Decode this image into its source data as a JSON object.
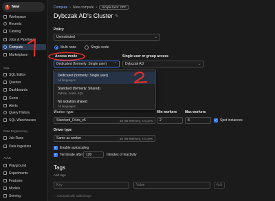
{
  "sidebar": {
    "new_label": "New",
    "items": [
      {
        "label": "Workspace",
        "icon": "workspace-icon"
      },
      {
        "label": "Recents",
        "icon": "clock-icon"
      },
      {
        "label": "Catalog",
        "icon": "catalog-icon"
      },
      {
        "label": "Jobs & Pipelines",
        "icon": "jobs-icon"
      },
      {
        "label": "Compute",
        "icon": "cloud-icon"
      },
      {
        "label": "Marketplace",
        "icon": "marketplace-icon"
      }
    ],
    "sql_section": "SQL",
    "sql_items": [
      {
        "label": "SQL Editor",
        "icon": "editor-icon"
      },
      {
        "label": "Queries",
        "icon": "queries-icon"
      },
      {
        "label": "Dashboards",
        "icon": "dashboard-icon"
      },
      {
        "label": "Genie",
        "icon": "genie-icon"
      },
      {
        "label": "Alerts",
        "icon": "bell-icon"
      },
      {
        "label": "Query History",
        "icon": "history-icon"
      },
      {
        "label": "SQL Warehouses",
        "icon": "warehouse-icon"
      }
    ],
    "de_section": "Data Engineering",
    "de_items": [
      {
        "label": "Job Runs",
        "icon": "runs-icon"
      },
      {
        "label": "Data Ingestion",
        "icon": "ingestion-icon"
      }
    ],
    "ml_section": "AI/ML",
    "ml_items": [
      {
        "label": "Playground",
        "icon": "playground-icon"
      },
      {
        "label": "Experiments",
        "icon": "experiments-icon"
      },
      {
        "label": "Features",
        "icon": "features-icon"
      },
      {
        "label": "Models",
        "icon": "models-icon"
      },
      {
        "label": "Serving",
        "icon": "serving-icon"
      }
    ]
  },
  "annotations": {
    "one": "1",
    "two": "2"
  },
  "header": {
    "breadcrumb": [
      "Compute",
      "New compute"
    ],
    "form_badge": "Simple form: OFF",
    "title": "Dybczak AD's Cluster"
  },
  "policy": {
    "label": "Policy",
    "value": "Unrestricted"
  },
  "node_mode": {
    "multi": "Multi node",
    "single": "Single node",
    "selected": "multi"
  },
  "access_mode": {
    "label": "Access mode",
    "value": "Dedicated (formerly: Single user)"
  },
  "user_access": {
    "label": "Single user or group access",
    "value": "Dybczak AD"
  },
  "dropdown_options": [
    {
      "title": "Dedicated (formerly: Single user)",
      "desc": "All languages"
    },
    {
      "title": "Standard (formerly: Shared)",
      "desc": "Python, Scala, SQL"
    },
    {
      "title": "No isolation shared",
      "desc": "All languages"
    }
  ],
  "worker": {
    "type_label": "Worker type",
    "type_value": "Standard_D4ds_v5",
    "type_spec": "16 GB Memory, 4 Cores",
    "min_label": "Min workers",
    "min_value": "2",
    "max_label": "Max workers",
    "max_value": "8",
    "spot_label": "Spot instances"
  },
  "driver": {
    "label": "Driver type",
    "value": "Same as worker",
    "spec": "16 GB Memory, 4 Cores"
  },
  "autoscaling": {
    "label": "Enable autoscaling"
  },
  "terminate": {
    "label": "Terminate after",
    "value": "120",
    "suffix": "minutes of inactivity"
  },
  "tags": {
    "title": "Tags",
    "add_label": "Add tags",
    "key_placeholder": "Key",
    "value_placeholder": "Value",
    "add_button": "Add",
    "auto_link": "Automatically added tags"
  },
  "colors": {
    "accent": "#3a7bff",
    "annotation": "#e0302a",
    "active_nav": "#2d3a4f"
  }
}
